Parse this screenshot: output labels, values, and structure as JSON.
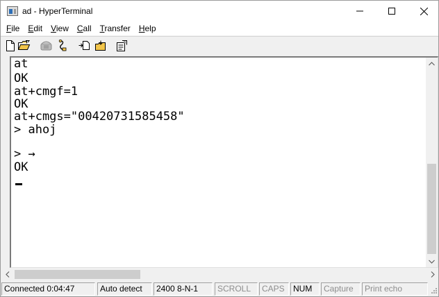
{
  "window": {
    "title": "ad - HyperTerminal",
    "icon": "hyperterminal-app-icon"
  },
  "title_controls": {
    "minimize_icon": "minimize-icon",
    "maximize_icon": "maximize-icon",
    "close_icon": "close-icon"
  },
  "menu": {
    "items": [
      {
        "mnemonic": "F",
        "rest": "ile"
      },
      {
        "mnemonic": "E",
        "rest": "dit"
      },
      {
        "mnemonic": "V",
        "rest": "iew"
      },
      {
        "mnemonic": "C",
        "rest": "all"
      },
      {
        "mnemonic": "T",
        "rest": "ransfer"
      },
      {
        "mnemonic": "H",
        "rest": "elp"
      }
    ]
  },
  "toolbar": {
    "buttons": [
      "new-file-icon",
      "open-folder-icon",
      "call-icon",
      "disconnect-icon",
      "send-file-icon",
      "receive-file-icon",
      "properties-icon"
    ]
  },
  "terminal": {
    "lines": [
      "at",
      "OK",
      "at+cmgf=1",
      "OK",
      "at+cmgs=\"00420731585458\"",
      "> ahoj",
      "",
      "> →",
      "OK"
    ]
  },
  "status": {
    "connected": "Connected 0:04:47",
    "detect": "Auto detect",
    "settings": "2400 8-N-1",
    "scroll": "SCROLL",
    "caps": "CAPS",
    "num": "NUM",
    "capture": "Capture",
    "print_echo": "Print echo"
  }
}
